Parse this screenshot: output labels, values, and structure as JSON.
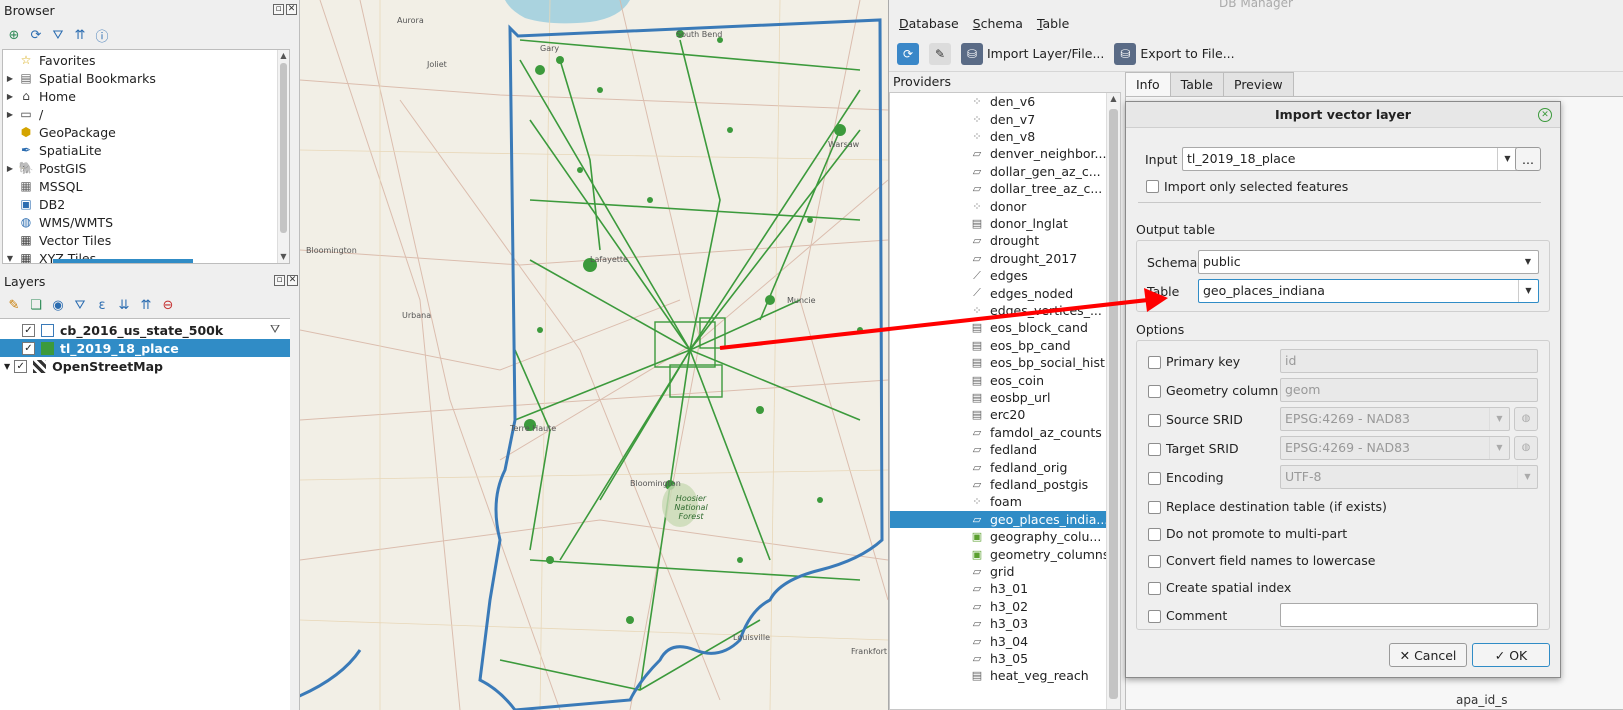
{
  "browser": {
    "title": "Browser",
    "items": [
      {
        "label": "Favorites",
        "icon": "star-icon",
        "expand": ""
      },
      {
        "label": "Spatial Bookmarks",
        "icon": "bookmark-icon",
        "expand": "▶"
      },
      {
        "label": "Home",
        "icon": "home-icon",
        "expand": "▶"
      },
      {
        "label": "/",
        "icon": "folder-icon",
        "expand": "▶"
      },
      {
        "label": "GeoPackage",
        "icon": "geopackage-icon",
        "expand": ""
      },
      {
        "label": "SpatiaLite",
        "icon": "spatialite-icon",
        "expand": ""
      },
      {
        "label": "PostGIS",
        "icon": "postgis-icon",
        "expand": "▶"
      },
      {
        "label": "MSSQL",
        "icon": "mssql-icon",
        "expand": ""
      },
      {
        "label": "DB2",
        "icon": "db2-icon",
        "expand": ""
      },
      {
        "label": "WMS/WMTS",
        "icon": "globe-icon",
        "expand": ""
      },
      {
        "label": "Vector Tiles",
        "icon": "grid-icon",
        "expand": ""
      },
      {
        "label": "XYZ Tiles",
        "icon": "grid-icon",
        "expand": "▼"
      }
    ]
  },
  "layers": {
    "title": "Layers",
    "items": [
      {
        "label": "cb_2016_us_state_500k",
        "checked": "✓",
        "selected": false,
        "swatch": "outline"
      },
      {
        "label": "tl_2019_18_place",
        "checked": "✓",
        "selected": true,
        "swatch": "green"
      },
      {
        "label": "OpenStreetMap",
        "checked": "✓",
        "selected": false,
        "swatch": "tiles"
      }
    ]
  },
  "map": {
    "labels": [
      "Aurora",
      "Joliet",
      "Gary",
      "South Bend",
      "Lafayette",
      "Urbana",
      "Muncie",
      "Terre Haute",
      "Bloomington",
      "Hoosier National Forest",
      "Louisville",
      "Frankfort",
      "Bloomington",
      "Warsaw"
    ]
  },
  "db": {
    "window_title": "DB Manager",
    "menu": [
      "Database",
      "Schema",
      "Table"
    ],
    "toolbar": {
      "import": "Import Layer/File...",
      "export": "Export to File..."
    },
    "providers_label": "Providers",
    "tabs": [
      "Info",
      "Table",
      "Preview"
    ],
    "tables": [
      {
        "name": "den_v6",
        "icon": "point-icon"
      },
      {
        "name": "den_v7",
        "icon": "point-icon"
      },
      {
        "name": "den_v8",
        "icon": "point-icon"
      },
      {
        "name": "denver_neighbor...",
        "icon": "polygon-icon"
      },
      {
        "name": "dollar_gen_az_c...",
        "icon": "polygon-icon"
      },
      {
        "name": "dollar_tree_az_c...",
        "icon": "polygon-icon"
      },
      {
        "name": "donor",
        "icon": "point-icon"
      },
      {
        "name": "donor_lnglat",
        "icon": "table-icon"
      },
      {
        "name": "drought",
        "icon": "polygon-icon"
      },
      {
        "name": "drought_2017",
        "icon": "polygon-icon"
      },
      {
        "name": "edges",
        "icon": "line-icon"
      },
      {
        "name": "edges_noded",
        "icon": "line-icon"
      },
      {
        "name": "edges_vertices_...",
        "icon": "point-icon"
      },
      {
        "name": "eos_block_cand",
        "icon": "table-icon"
      },
      {
        "name": "eos_bp_cand",
        "icon": "table-icon"
      },
      {
        "name": "eos_bp_social_hist",
        "icon": "table-icon"
      },
      {
        "name": "eos_coin",
        "icon": "table-icon"
      },
      {
        "name": "eosbp_url",
        "icon": "table-icon"
      },
      {
        "name": "erc20",
        "icon": "table-icon"
      },
      {
        "name": "famdol_az_counts",
        "icon": "polygon-icon"
      },
      {
        "name": "fedland",
        "icon": "polygon-icon"
      },
      {
        "name": "fedland_orig",
        "icon": "polygon-icon"
      },
      {
        "name": "fedland_postgis",
        "icon": "polygon-icon"
      },
      {
        "name": "foam",
        "icon": "point-icon"
      },
      {
        "name": "geo_places_india...",
        "icon": "polygon-icon",
        "selected": true
      },
      {
        "name": "geography_colu...",
        "icon": "view-icon"
      },
      {
        "name": "geometry_columns",
        "icon": "view-icon"
      },
      {
        "name": "grid",
        "icon": "polygon-icon"
      },
      {
        "name": "h3_01",
        "icon": "polygon-icon"
      },
      {
        "name": "h3_02",
        "icon": "polygon-icon"
      },
      {
        "name": "h3_03",
        "icon": "polygon-icon"
      },
      {
        "name": "h3_04",
        "icon": "polygon-icon"
      },
      {
        "name": "h3_05",
        "icon": "polygon-icon"
      },
      {
        "name": "heat_veg_reach",
        "icon": "table-icon"
      }
    ],
    "bg_text": "apa_id_s"
  },
  "dialog": {
    "title": "Import vector layer",
    "input_label": "Input",
    "input_value": "tl_2019_18_place",
    "browse_label": "...",
    "only_selected": "Import only selected features",
    "output_table": "Output table",
    "schema_label": "Schema",
    "schema_value": "public",
    "table_label": "Table",
    "table_value": "geo_places_indiana",
    "options": "Options",
    "opts": [
      {
        "label": "Primary key",
        "value": "id",
        "kind": "text"
      },
      {
        "label": "Geometry column",
        "value": "geom",
        "kind": "text"
      },
      {
        "label": "Source SRID",
        "value": "EPSG:4269 - NAD83",
        "kind": "combo"
      },
      {
        "label": "Target SRID",
        "value": "EPSG:4269 - NAD83",
        "kind": "combo"
      },
      {
        "label": "Encoding",
        "value": "UTF-8",
        "kind": "combo"
      }
    ],
    "checks": [
      "Replace destination table (if exists)",
      "Do not promote to multi-part",
      "Convert field names to lowercase",
      "Create spatial index"
    ],
    "comment_label": "Comment",
    "cancel": "Cancel",
    "ok": "OK"
  },
  "colors": {
    "selection": "#308cc6",
    "places": "#3c9a3c",
    "state_outline": "#3a7ab8",
    "arrow": "#ff0000"
  }
}
